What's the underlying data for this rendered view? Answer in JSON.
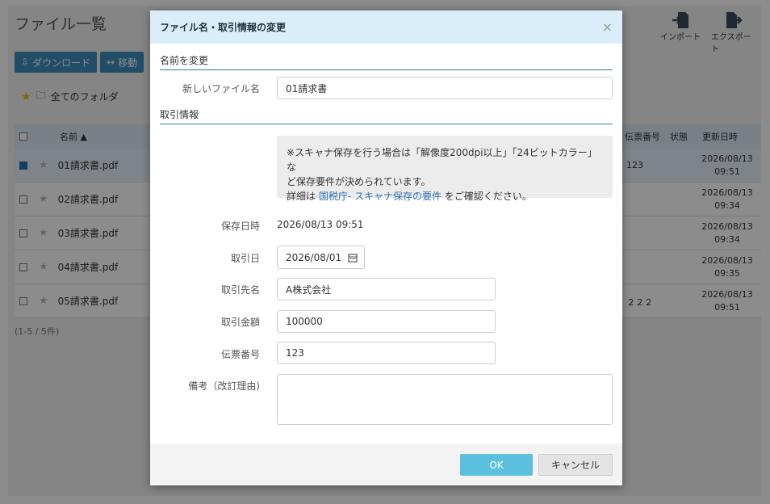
{
  "background": {
    "title": "ファイル一覧",
    "toolbar": {
      "download": "ダウンロード",
      "move": "移動"
    },
    "breadcrumb": {
      "all_folders": "全てのフォルダ"
    },
    "tools": {
      "import": "インポート",
      "export": "エクスポート"
    },
    "table": {
      "headers": {
        "name": "名前 ▲",
        "slip_number": "伝票番号",
        "status": "状態",
        "updated": "更新日時"
      },
      "rows": [
        {
          "name": "01請求書.pdf",
          "slip": "123",
          "updated_date": "2026/08/13",
          "updated_time": "09:51"
        },
        {
          "name": "02請求書.pdf",
          "slip": "",
          "updated_date": "2026/08/13",
          "updated_time": "09:34"
        },
        {
          "name": "03請求書.pdf",
          "slip": "",
          "updated_date": "2026/08/13",
          "updated_time": "09:34"
        },
        {
          "name": "04請求書.pdf",
          "slip": "",
          "updated_date": "2026/08/13",
          "updated_time": "09:35"
        },
        {
          "name": "05請求書.pdf",
          "slip": "２２２",
          "updated_date": "2026/08/13",
          "updated_time": "09:51"
        }
      ]
    },
    "count": "(1-5 / 5件)"
  },
  "modal": {
    "title": "ファイル名・取引情報の変更",
    "section_rename": "名前を変更",
    "new_file_name_label": "新しいファイル名",
    "new_file_name_value": "01請求書",
    "section_transaction": "取引情報",
    "note_line1": "※スキャナ保存を行う場合は「解像度200dpi以上」「24ビットカラー」な",
    "note_line2": "ど保存要件が決められています。",
    "note_prefix": "詳細は",
    "note_link": "国税庁- スキャナ保存の要件",
    "note_suffix": "をご確認ください。",
    "saved_at_label": "保存日時",
    "saved_at_value": "2026/08/13 09:51",
    "transaction_date_label": "取引日",
    "transaction_date_value": "2026/08/01",
    "counterparty_label": "取引先名",
    "counterparty_value": "A株式会社",
    "amount_label": "取引金額",
    "amount_value": "100000",
    "slip_label": "伝票番号",
    "slip_value": "123",
    "remarks_label": "備考（改訂理由)",
    "remarks_value": "",
    "ok": "OK",
    "cancel": "キャンセル"
  }
}
